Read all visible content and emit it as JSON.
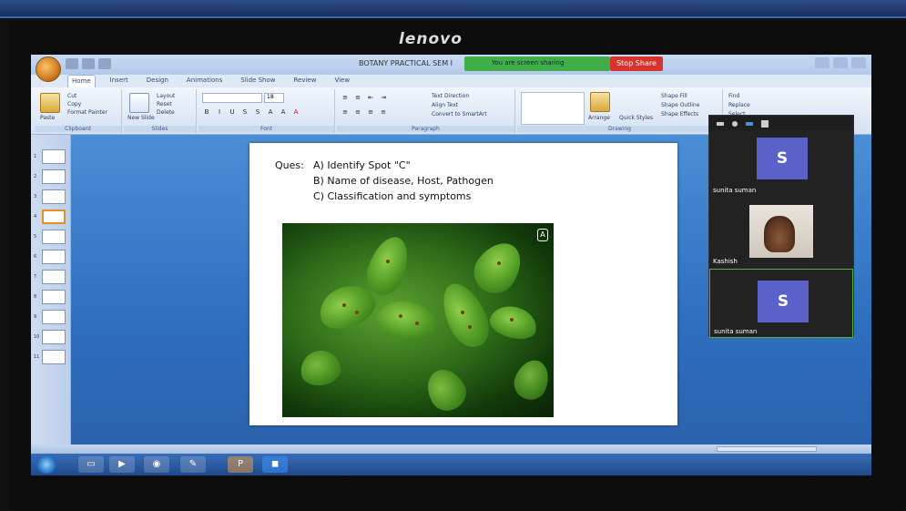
{
  "monitor": {
    "brand": "lenovo"
  },
  "window": {
    "doc_title": "BOTANY PRACTICAL SEM I"
  },
  "share": {
    "status": "You are screen sharing",
    "stop_label": "Stop Share"
  },
  "ribbon": {
    "tabs": [
      "Home",
      "Insert",
      "Design",
      "Animations",
      "Slide Show",
      "Review",
      "View"
    ],
    "clipboard": {
      "paste": "Paste",
      "cut": "Cut",
      "copy": "Copy",
      "format_painter": "Format Painter",
      "label": "Clipboard"
    },
    "slides": {
      "new_slide": "New Slide",
      "layout": "Layout",
      "reset": "Reset",
      "delete": "Delete",
      "label": "Slides"
    },
    "font": {
      "size": "18",
      "label": "Font"
    },
    "paragraph": {
      "text_direction": "Text Direction",
      "align_text": "Align Text",
      "smartart": "Convert to SmartArt",
      "label": "Paragraph"
    },
    "drawing": {
      "arrange": "Arrange",
      "quick_styles": "Quick Styles",
      "shape_fill": "Shape Fill",
      "shape_outline": "Shape Outline",
      "shape_effects": "Shape Effects",
      "label": "Drawing"
    },
    "editing": {
      "find": "Find",
      "replace": "Replace",
      "select": "Select"
    }
  },
  "slide_thumbs": [
    "1",
    "2",
    "3",
    "4",
    "5",
    "6",
    "7",
    "8",
    "9",
    "10",
    "11"
  ],
  "slide": {
    "ques": "Ques:",
    "a": "A) Identify Spot \"C\"",
    "b": "B)  Name of disease, Host, Pathogen",
    "c": "C) Classification and symptoms"
  },
  "participants": [
    {
      "name": "sunita suman",
      "initial": "S",
      "type": "avatar"
    },
    {
      "name": "Kashish",
      "type": "video"
    },
    {
      "name": "sunita suman",
      "initial": "S",
      "type": "avatar",
      "active": true
    }
  ],
  "colors": {
    "share_green": "#3fae49",
    "stop_red": "#d8342f",
    "avatar": "#5a62c9"
  }
}
